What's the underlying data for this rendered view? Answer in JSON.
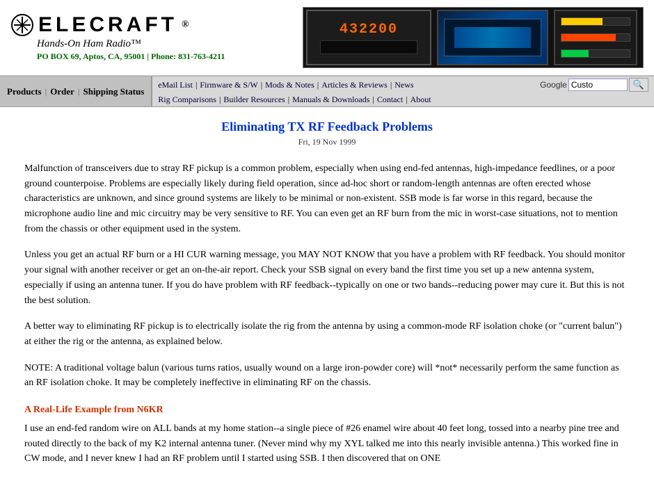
{
  "header": {
    "logo_brand": "ELECRAFT",
    "tagline": "Hands-On Ham Radio™",
    "address": "PO BOX 69, Aptos, CA, 95001",
    "phone": "Phone: 831-763-4211"
  },
  "nav": {
    "left_links": [
      {
        "label": "Products",
        "id": "products"
      },
      {
        "label": "Order",
        "id": "order"
      },
      {
        "label": "Shipping Status",
        "id": "shipping"
      }
    ],
    "left_sep": "|",
    "top_row": [
      {
        "label": "eMail List",
        "id": "email-list"
      },
      {
        "label": "Firmware & S/W",
        "id": "firmware"
      },
      {
        "label": "Mods & Notes",
        "id": "mods"
      },
      {
        "label": "Articles & Reviews",
        "id": "articles"
      },
      {
        "label": "News",
        "id": "news"
      }
    ],
    "bottom_row": [
      {
        "label": "Rig Comparisons",
        "id": "rig-comp"
      },
      {
        "label": "Builder Resources",
        "id": "builder"
      },
      {
        "label": "Manuals & Downloads",
        "id": "manuals"
      },
      {
        "label": "Contact",
        "id": "contact"
      },
      {
        "label": "About",
        "id": "about"
      }
    ],
    "search_label": "Google",
    "search_placeholder": "Custo",
    "search_button": "🔍"
  },
  "article": {
    "title": "Eliminating TX RF Feedback Problems",
    "date": "Fri, 19 Nov 1999",
    "paragraphs": [
      "Malfunction of transceivers due to stray RF pickup is a common problem, especially when using end-fed antennas, high-impedance feedlines, or a poor ground counterpoise. Problems are especially likely during field operation, since ad-hoc short or random-length antennas are often erected whose characteristics are unknown, and since ground systems are likely to be minimal or non-existent. SSB mode is far worse in this regard, because the microphone audio line and mic circuitry may be very sensitive to RF. You can even get an RF burn from the mic in worst-case situations, not to mention from the chassis or other equipment used in the system.",
      "Unless you get an actual RF burn or a HI CUR warning message, you MAY NOT KNOW that you have a problem with RF feedback. You should monitor your signal with another receiver or get an on-the-air report. Check your SSB signal on every band the first time you set up a new antenna system, especially if using an antenna tuner. If you do have problem with RF feedback--typically on one or two bands--reducing power may cure it. But this is not the best solution.",
      "A better way to eliminating RF pickup is to electrically isolate the rig from the antenna by using a common-mode RF isolation choke (or \"current balun\") at either the rig or the antenna, as explained below.",
      "NOTE: A traditional voltage balun (various turns ratios, usually wound on a large iron-powder core) will *not* necessarily perform the same function as an RF isolation choke. It may be completely ineffective in eliminating RF on the chassis."
    ],
    "section_heading": "A Real-Life Example from N6KR",
    "section_para": "I use an end-fed random wire on ALL bands at my home station--a single piece of #26 enamel wire about 40 feet long, tossed into a nearby pine tree and routed directly to the back of my K2 internal antenna tuner. (Never mind why my XYL talked me into this nearly invisible antenna.) This worked fine in CW mode, and I never knew I had an RF problem until I started using SSB. I then discovered that on ONE"
  }
}
